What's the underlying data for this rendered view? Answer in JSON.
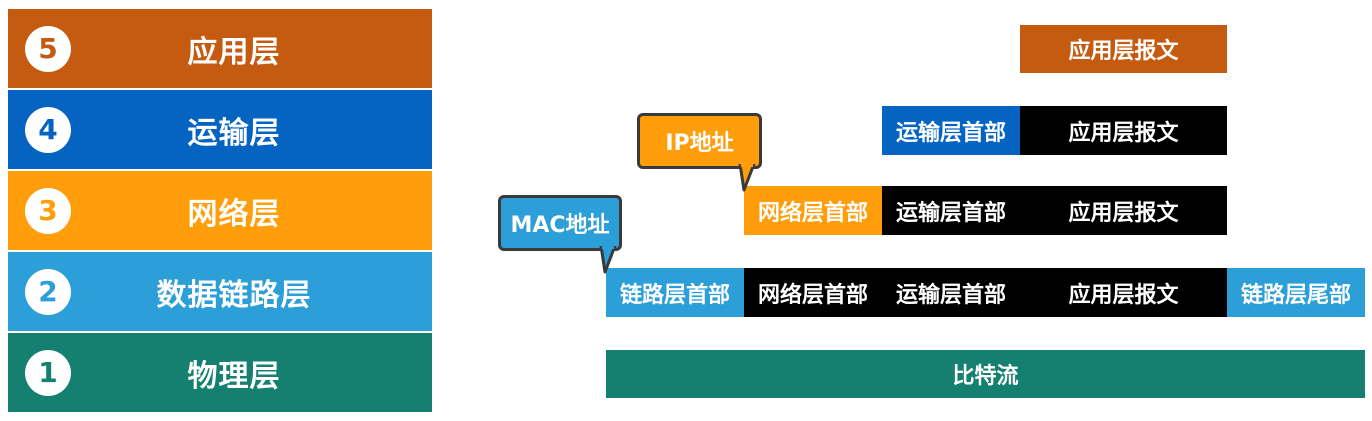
{
  "colors": {
    "application": "#C55A11",
    "transport": "#0563C1",
    "network": "#FF9E0A",
    "datalink": "#2C9ED8",
    "physical": "#15806F",
    "header_dark": "#000000",
    "callout_ip": "#FF9E0A",
    "callout_mac": "#2C9ED8"
  },
  "layers": [
    {
      "number": "5",
      "name": "应用层"
    },
    {
      "number": "4",
      "name": "运输层"
    },
    {
      "number": "3",
      "name": "网络层"
    },
    {
      "number": "2",
      "name": "数据链路层"
    },
    {
      "number": "1",
      "name": "物理层"
    }
  ],
  "pdu": {
    "app_message": "应用层报文",
    "transport_header": "运输层首部",
    "network_header": "网络层首部",
    "link_header": "链路层首部",
    "link_trailer": "链路层尾部",
    "bitstream": "比特流"
  },
  "callouts": {
    "ip": "IP地址",
    "mac": "MAC地址"
  }
}
